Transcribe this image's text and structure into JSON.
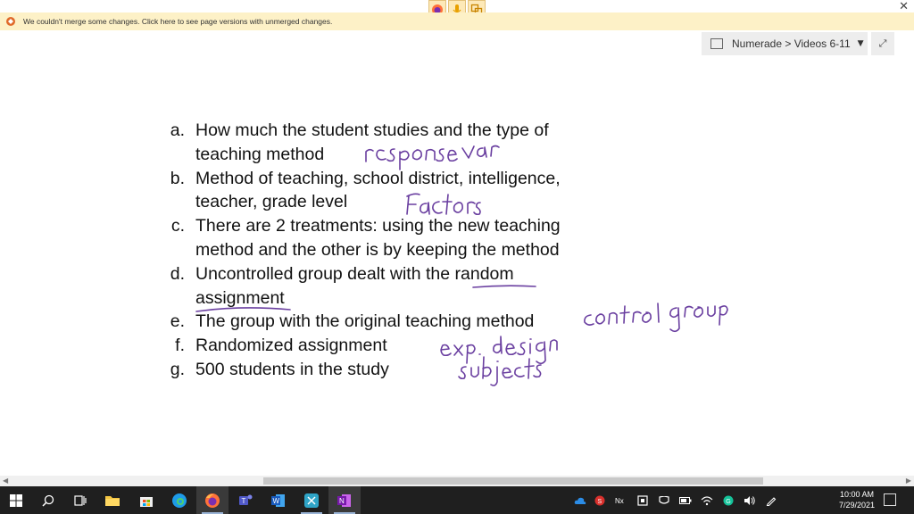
{
  "window": {
    "close_glyph": "✕",
    "float_buttons": [
      "firefox-icon",
      "microphone-icon",
      "screen-clip-icon"
    ]
  },
  "warning_bar": {
    "icon": "merge-warning-icon",
    "text": "We couldn't merge some changes. Click here to see page versions with unmerged changes."
  },
  "notebook_nav": {
    "label": "Numerade > Videos 6-11",
    "caret": "▼",
    "expand_glyph": "⤢"
  },
  "content": {
    "items": [
      {
        "letter": "a.",
        "text": "How much the student studies and the type of teaching method"
      },
      {
        "letter": "b.",
        "text": "Method of teaching, school district, intelligence, teacher, grade level"
      },
      {
        "letter": "c.",
        "text": "There are 2 treatments:  using the new teaching method and the other is by keeping the method"
      },
      {
        "letter": "d.",
        "text": "Uncontrolled group dealt with the random assignment"
      },
      {
        "letter": "e.",
        "text": "The group with the original teaching method"
      },
      {
        "letter": "f.",
        "text": "Randomized assignment"
      },
      {
        "letter": "g.",
        "text": "500 students in the study"
      }
    ]
  },
  "annotations": {
    "color": "#6a3fa0",
    "notes": [
      "response var",
      "Factors",
      "control group",
      "exp. design",
      "subjects"
    ]
  },
  "taskbar": {
    "apps": [
      "windows-start-icon",
      "search-icon",
      "task-view-icon",
      "file-explorer-icon",
      "store-icon",
      "edge-icon",
      "firefox-icon",
      "teams-icon",
      "word-icon",
      "snipping-tool-icon",
      "onenote-icon"
    ],
    "tray": [
      "onedrive-icon",
      "app-s-icon",
      "app-n-icon",
      "security-icon",
      "battery-icon",
      "wifi-icon",
      "grammarly-icon",
      "volume-icon",
      "pen-icon"
    ],
    "time": "10:00 AM",
    "date": "7/29/2021"
  }
}
